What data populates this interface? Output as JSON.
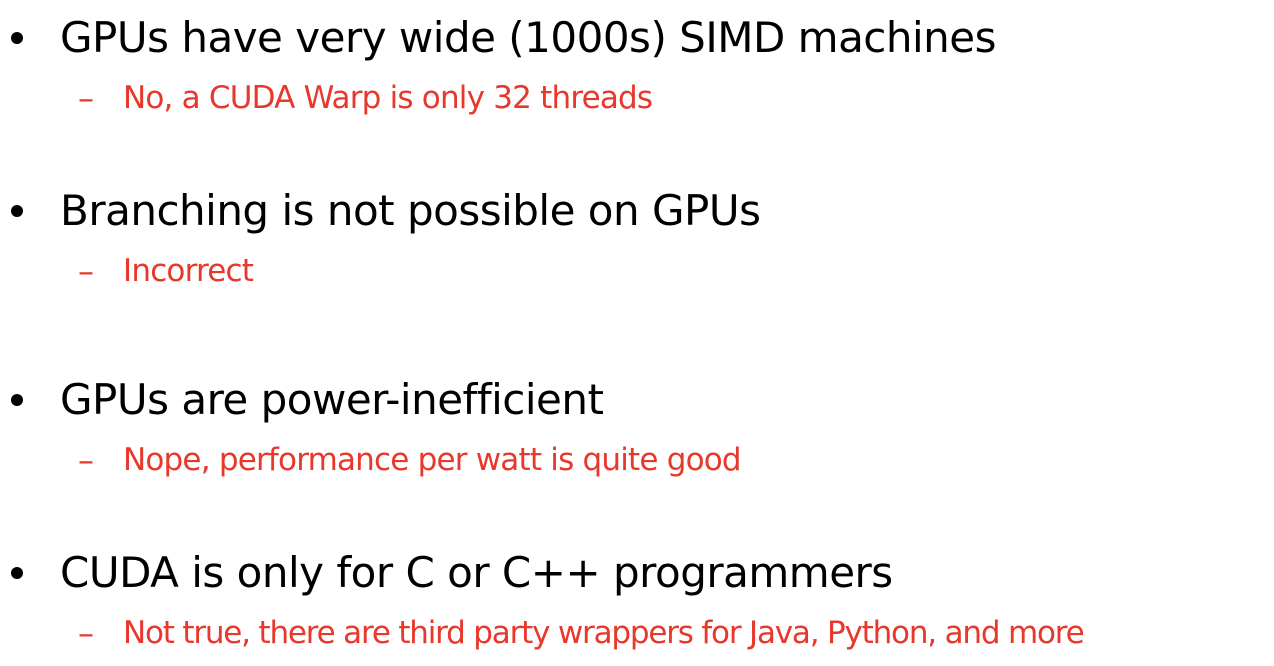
{
  "slide": {
    "bullets": [
      {
        "text": "GPUs have very wide (1000s) SIMD machines",
        "sub_marker": "–",
        "sub_text": "No, a CUDA Warp is only 32 threads"
      },
      {
        "text": "Branching is not possible on GPUs",
        "sub_marker": "–",
        "sub_text": "Incorrect"
      },
      {
        "text": "GPUs are power-inefficient",
        "sub_marker": "–",
        "sub_text": "Nope, performance per watt is quite good"
      },
      {
        "text": "CUDA is only for C or C++ programmers",
        "sub_marker": "–",
        "sub_text": "Not true, there are third party wrappers for Java, Python, and more"
      }
    ],
    "colors": {
      "main_text": "#000000",
      "sub_text": "#e8372b",
      "background": "#ffffff"
    }
  }
}
